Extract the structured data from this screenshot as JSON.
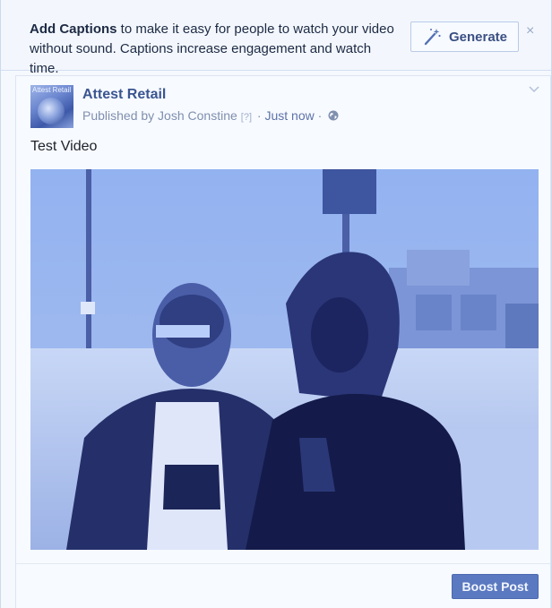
{
  "banner": {
    "title": "Add Captions",
    "text": " to make it easy for people to watch your video without sound. Captions increase engagement and watch time.",
    "generate_label": "Generate",
    "generate_icon": "magic-wand-icon",
    "close_label": "×"
  },
  "post": {
    "page_name": "Attest Retail",
    "avatar_text": "Attest Retail",
    "published_by": "Published by Josh Constine",
    "help_marker": "[?]",
    "separator_1": " · ",
    "time": "Just now",
    "separator_2": " · ",
    "privacy_icon": "globe-icon",
    "text": "Test Video",
    "video_icon": "video-thumbnail",
    "boost_label": "Boost Post"
  },
  "colors": {
    "accent": "#5b79c0",
    "link": "#3b5590",
    "banner_bg": "#f3f7fd"
  }
}
